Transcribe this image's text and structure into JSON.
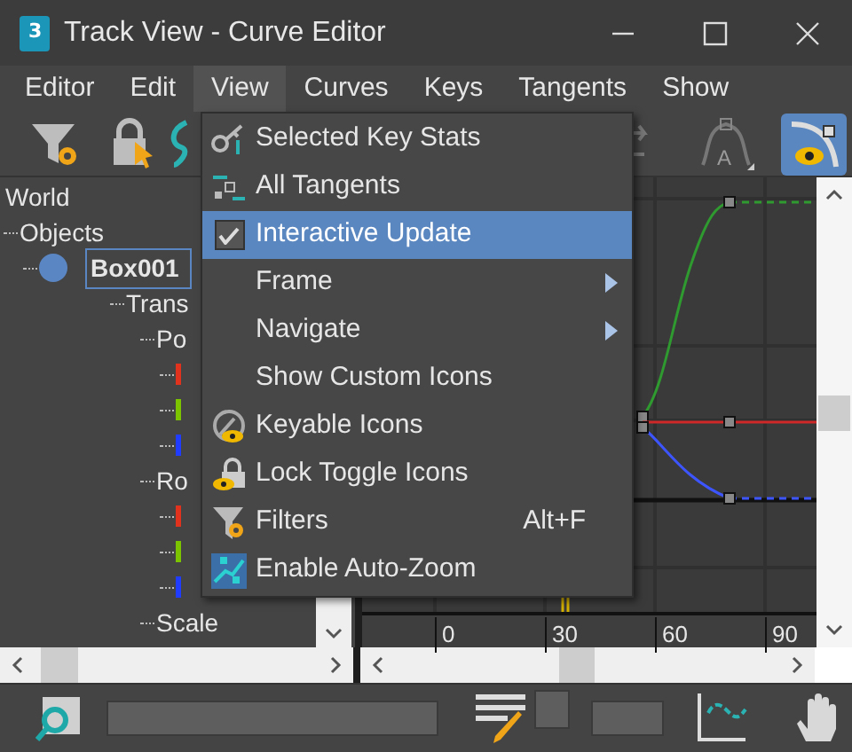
{
  "window": {
    "title": "Track View - Curve Editor",
    "app_icon_text": "3"
  },
  "menu_bar": [
    {
      "label": "Editor",
      "selected": false
    },
    {
      "label": "Edit",
      "selected": false
    },
    {
      "label": "View",
      "selected": true
    },
    {
      "label": "Curves",
      "selected": false
    },
    {
      "label": "Keys",
      "selected": false
    },
    {
      "label": "Tangents",
      "selected": false
    },
    {
      "label": "Show",
      "selected": false
    }
  ],
  "toolbar": {
    "show_curves_on": true,
    "tangent_icon_text": "A"
  },
  "tree": [
    {
      "label": "World",
      "children": [
        {
          "label": "Objects",
          "children": [
            {
              "label": "Box001",
              "selected": true,
              "children": [
                {
                  "label": "Trans",
                  "children": [
                    {
                      "label": "Po",
                      "children": [
                        {
                          "color": "#e0321c"
                        },
                        {
                          "color": "#7cc400"
                        },
                        {
                          "color": "#1f3cff"
                        }
                      ]
                    },
                    {
                      "label": "Ro",
                      "children": [
                        {
                          "color": "#e0321c"
                        },
                        {
                          "color": "#7cc400"
                        },
                        {
                          "color": "#1f3cff"
                        }
                      ]
                    },
                    {
                      "label": "Scale"
                    }
                  ]
                }
              ]
            }
          ]
        }
      ]
    }
  ],
  "ruler": [
    "0",
    "30",
    "60",
    "90"
  ],
  "view_menu": [
    {
      "kind": "item",
      "label": "Selected Key Stats",
      "selected": false
    },
    {
      "kind": "item",
      "label": "All Tangents",
      "selected": false
    },
    {
      "kind": "check",
      "label": "Interactive Update",
      "checked": true,
      "selected": true
    },
    {
      "kind": "submenu",
      "label": "Frame",
      "selected": false
    },
    {
      "kind": "submenu",
      "label": "Navigate",
      "selected": false
    },
    {
      "kind": "item",
      "label": "Show Custom Icons",
      "selected": false
    },
    {
      "kind": "item",
      "label": "Keyable Icons",
      "selected": false
    },
    {
      "kind": "item",
      "label": "Lock Toggle Icons",
      "selected": false
    },
    {
      "kind": "item",
      "label": "Filters",
      "shortcut": "Alt+F",
      "selected": false
    },
    {
      "kind": "item",
      "label": "Enable Auto-Zoom",
      "selected": false
    }
  ]
}
